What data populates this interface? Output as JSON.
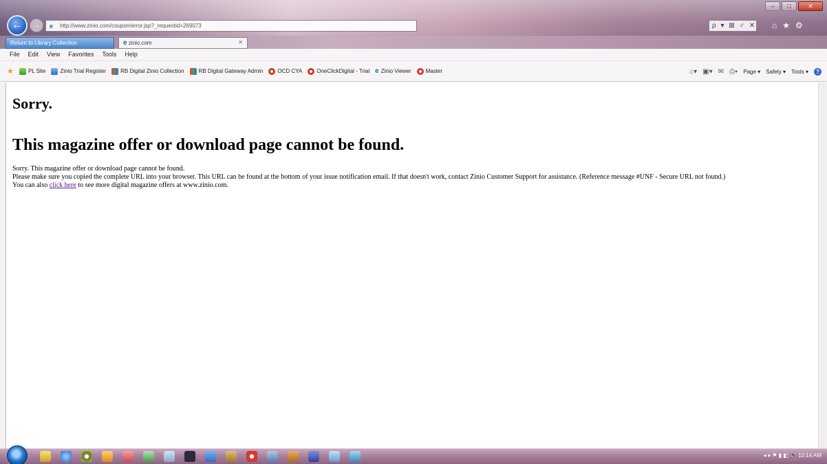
{
  "browser": {
    "address_url": "http://www.zinio.com/coupon/error.jsp?_requestid=269073",
    "address_tools": "ρ ▾ ⊠ ♂ ✕",
    "tabs": [
      {
        "label": "Return to Library Collection"
      },
      {
        "label": "zinio.com",
        "close": "✕"
      }
    ],
    "menu": [
      "File",
      "Edit",
      "View",
      "Favorites",
      "Tools",
      "Help"
    ],
    "favorites": [
      {
        "label": "PL Site",
        "icon": "people-icon"
      },
      {
        "label": "Zinio Trial Register",
        "icon": "page-icon"
      },
      {
        "label": "RB Digital Zinio Collection",
        "icon": "rbdigital-icon"
      },
      {
        "label": "RB Digital Gateway Admin",
        "icon": "rbdigital-icon"
      },
      {
        "label": "OCD CYA",
        "icon": "oneclick-icon"
      },
      {
        "label": "OneClickDigital - Trial",
        "icon": "oneclick-icon"
      },
      {
        "label": "Zinio Viewer",
        "icon": "ie-icon"
      },
      {
        "label": "Master",
        "icon": "oneclick-icon"
      }
    ],
    "command_bar": {
      "page": "Page ▾",
      "safety": "Safety ▾",
      "tools": "Tools ▾"
    }
  },
  "page": {
    "heading_sorry": "Sorry.",
    "heading_main": "This magazine offer or download page cannot be found.",
    "line1": "Sorry. This magazine offer or download page cannot be found.",
    "line2": "Please make sure you copied the complete URL into your browser. This URL can be found at the bottom of your issue notification email. If that doesn't work, contact Zinio Customer Support for assistance. (Reference message #UNF - Secure URL not found.)",
    "line3_prefix": "You can also ",
    "line3_link": "click here",
    "line3_suffix": " to see more digital magazine offers at www.zinio.com."
  },
  "taskbar": {
    "clock": "10:14 AM"
  }
}
